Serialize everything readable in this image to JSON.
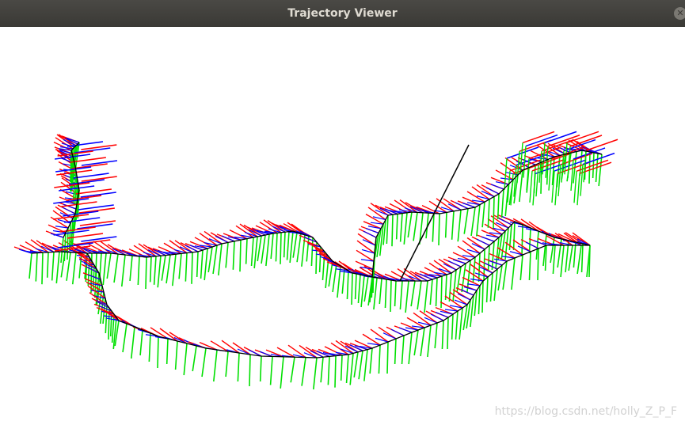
{
  "window": {
    "title": "Trajectory Viewer",
    "close_icon": "close-icon"
  },
  "viewer": {
    "background": "#ffffff",
    "axis_colors": {
      "x": "#ff0000",
      "y": "#00e000",
      "z": "#0000ff"
    },
    "trajectory_color": "#000000"
  },
  "watermark": "https://blog.csdn.net/holly_Z_P_F"
}
